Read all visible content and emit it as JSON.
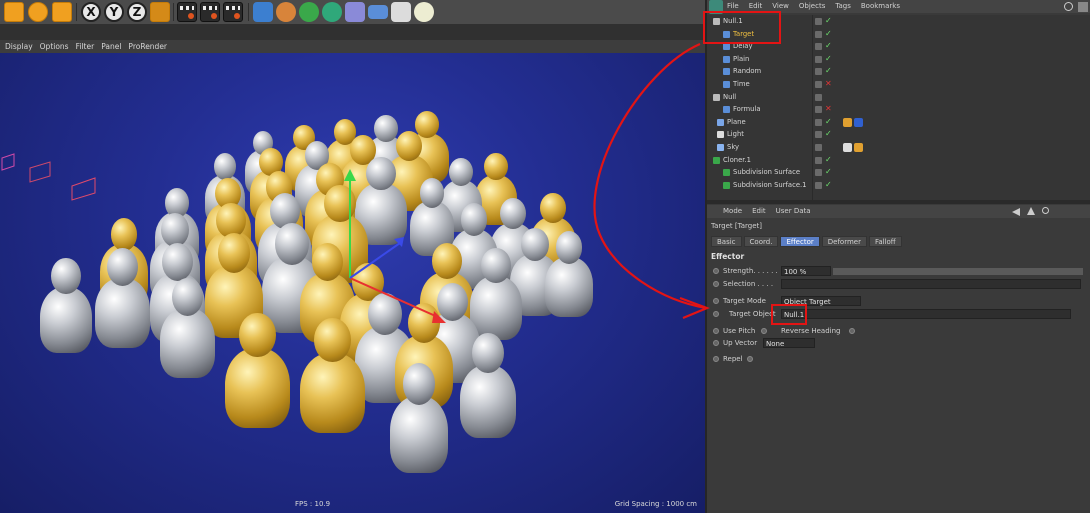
{
  "toolbar": {
    "axis_x": "X",
    "axis_y": "Y",
    "axis_z": "Z"
  },
  "viewport": {
    "menu": [
      "Display",
      "Options",
      "Filter",
      "Panel",
      "ProRender"
    ],
    "fps": "FPS : 10.9",
    "grid_spacing": "Grid Spacing : 1000 cm"
  },
  "object_manager": {
    "menu": [
      "File",
      "Edit",
      "View",
      "Objects",
      "Tags",
      "Bookmarks"
    ],
    "objects": [
      {
        "name": "Null.1",
        "status": "ok"
      },
      {
        "name": "Target",
        "status": "ok",
        "highlight": true
      },
      {
        "name": "Delay",
        "status": "ok"
      },
      {
        "name": "Plain",
        "status": "ok"
      },
      {
        "name": "Random",
        "status": "ok"
      },
      {
        "name": "Time",
        "status": "bad"
      },
      {
        "name": "Null",
        "status": ""
      },
      {
        "name": "Formula",
        "status": "bad"
      },
      {
        "name": "Plane",
        "status": "ok"
      },
      {
        "name": "Light",
        "status": "ok"
      },
      {
        "name": "Sky",
        "status": ""
      },
      {
        "name": "Cloner.1",
        "status": "ok"
      },
      {
        "name": "Subdivision Surface",
        "status": "ok"
      },
      {
        "name": "Subdivision Surface.1",
        "status": "ok"
      }
    ]
  },
  "attributes": {
    "menu": [
      "Mode",
      "Edit",
      "User Data"
    ],
    "title": "Target [Target]",
    "tabs": [
      "Basic",
      "Coord.",
      "Effector",
      "Deformer",
      "Falloff"
    ],
    "active_tab": "Effector",
    "section": "Effector",
    "strength_label": "Strength. . . . . .",
    "strength_value": "100 %",
    "strength_level": 1.0,
    "selection_label": "Selection . . . .",
    "target_mode_label": "Target Mode",
    "target_mode_value": "Object Target",
    "target_object_label": "Target Object",
    "target_object_value": "Null.1",
    "use_pitch_label": "Use Pitch",
    "reverse_heading_label": "Reverse Heading",
    "up_vector_label": "Up Vector",
    "up_vector_value": "None",
    "repel_label": "Repel"
  },
  "colors": {
    "annotation": "#e31414",
    "active_tab": "#5b7fc7",
    "ok": "#6de06d",
    "bad": "#e03535",
    "viewport_bg": "#232e92"
  }
}
